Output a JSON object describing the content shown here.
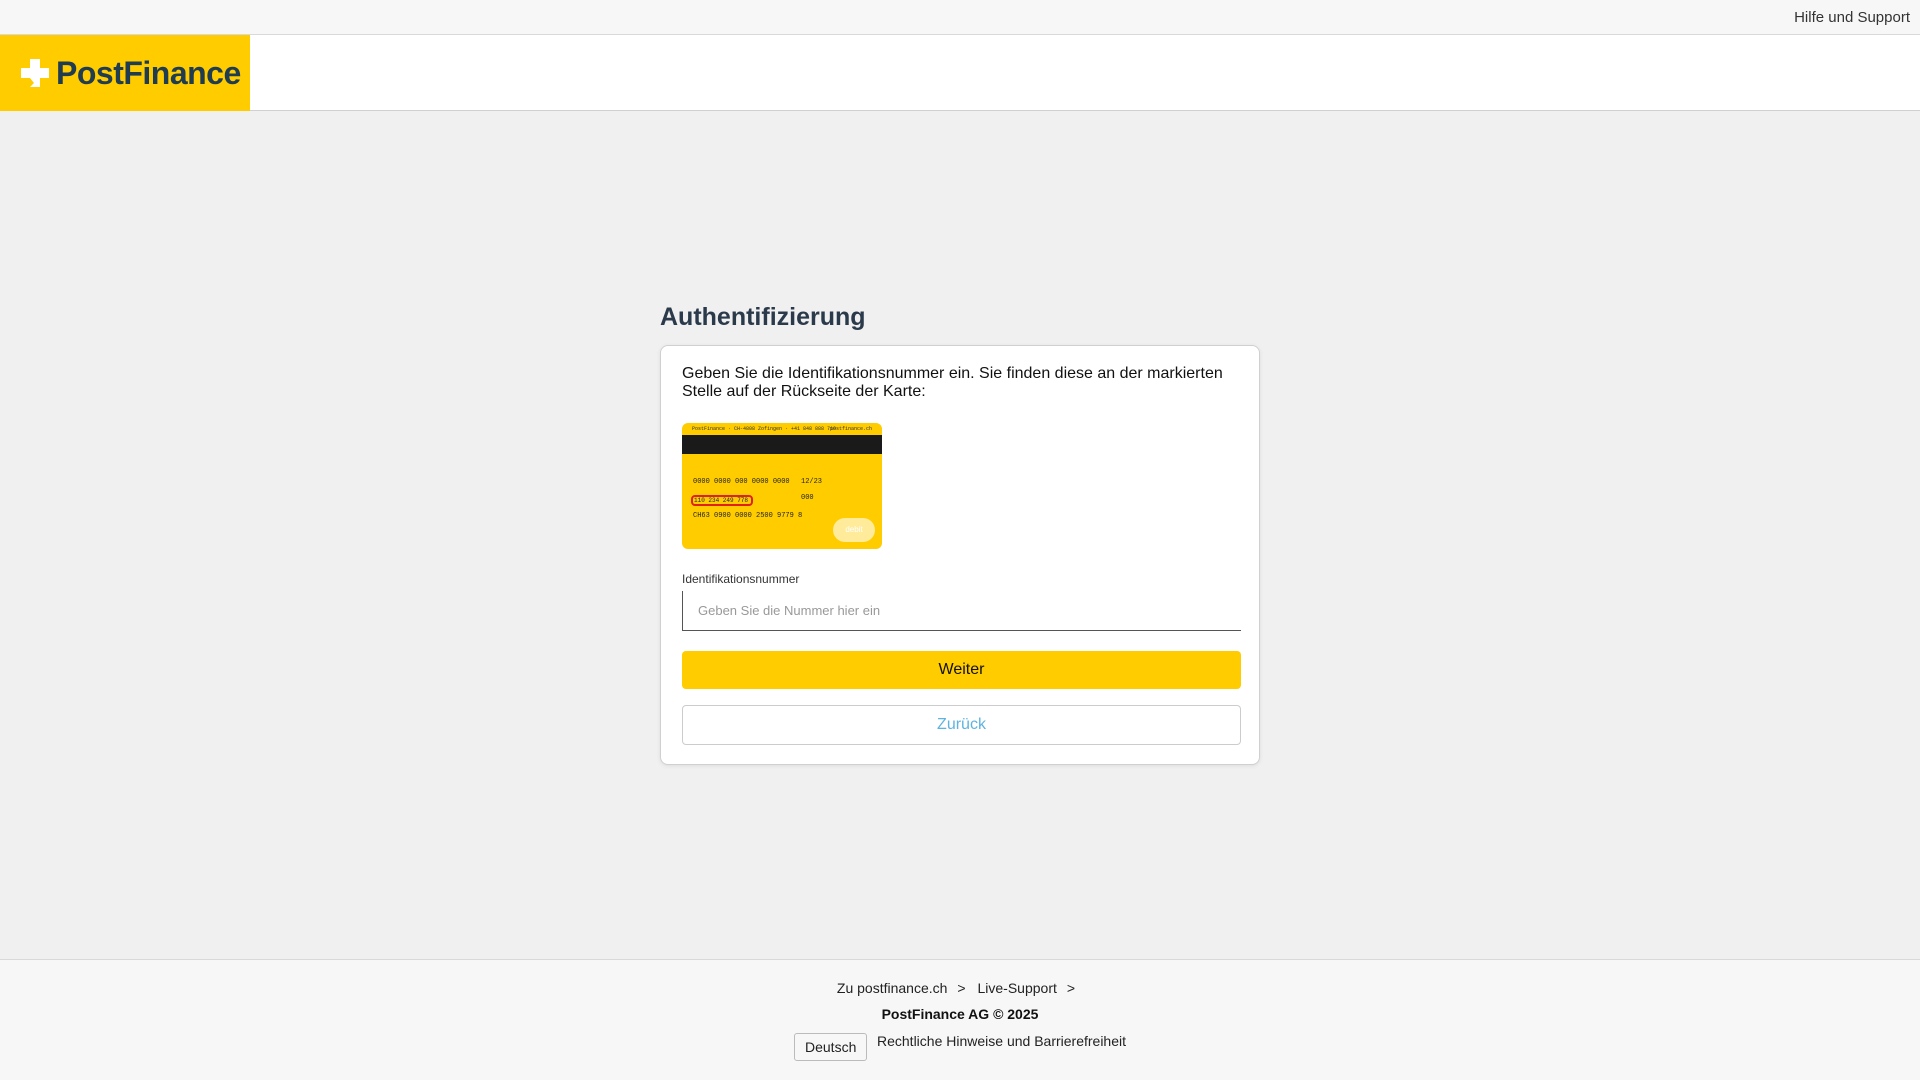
{
  "topbar": {
    "help_label": "Hilfe und Support"
  },
  "header": {
    "brand_name": "PostFinance",
    "brand_color": "#ffcc00"
  },
  "main": {
    "title": "Authentifizierung",
    "instruction": "Geben Sie die Identifikationsnummer ein. Sie finden diese an der markierten Stelle auf der Rückseite der Karte:",
    "card_image": {
      "top_line_left": "PostFinance · CH-4808 Zofingen · +41 848 888 710",
      "top_line_right": "postfinance.ch",
      "card_number": "0000 0000 000 0000 0000",
      "expiry": "12/23",
      "cvc": "000",
      "id_number": "110 234 249 778",
      "iban": "CH63 0900 0000 2500 9779 8",
      "badge": "debit",
      "highlight_color": "#e0201b"
    },
    "field_label": "Identifikationsnummer",
    "field_placeholder": "Geben Sie die Nummer hier ein",
    "field_value": "",
    "primary_button": "Weiter",
    "secondary_button": "Zurück"
  },
  "footer": {
    "link_postfinance": "Zu postfinance.ch",
    "link_support": "Live-Support",
    "chevron": ">",
    "copyright": "PostFinance AG © 2025",
    "language": "Deutsch",
    "legal": "Rechtliche Hinweise und Barrierefreiheit"
  },
  "colors": {
    "accent": "#ffcc00",
    "link": "#5fb3e0",
    "title": "#2b3a4a"
  }
}
